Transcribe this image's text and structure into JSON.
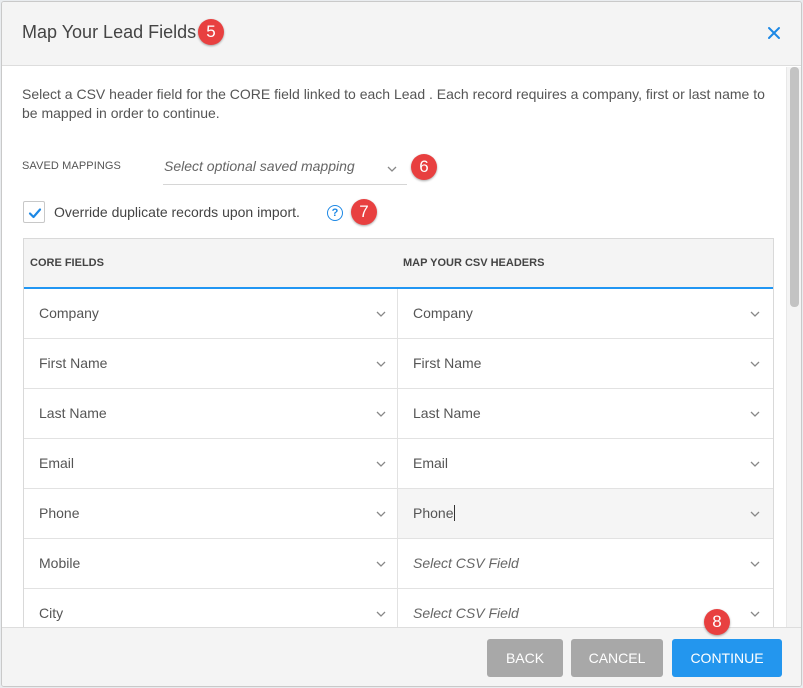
{
  "modal": {
    "title": "Map Your Lead Fields",
    "close_icon": "close-icon"
  },
  "badges": [
    "5",
    "6",
    "7",
    "8"
  ],
  "description": "Select a CSV header field for the CORE field linked to each Lead . Each record requires a company, first or last name to be mapped in order to continue.",
  "saved_mappings": {
    "label": "SAVED MAPPINGS",
    "placeholder": "Select optional saved mapping"
  },
  "override": {
    "checked": true,
    "label": "Override duplicate records upon import.",
    "help": "?"
  },
  "table": {
    "headers": [
      "CORE FIELDS",
      "MAP YOUR CSV HEADERS"
    ],
    "rows": [
      {
        "core": "Company",
        "csv": "Company"
      },
      {
        "core": "First Name",
        "csv": "First Name"
      },
      {
        "core": "Last Name",
        "csv": "Last Name"
      },
      {
        "core": "Email",
        "csv": "Email"
      },
      {
        "core": "Phone",
        "csv": "Phone"
      },
      {
        "core": "Mobile",
        "csv": "Select CSV Field"
      },
      {
        "core": "City",
        "csv": "Select CSV Field"
      }
    ]
  },
  "footer": {
    "back": "BACK",
    "cancel": "CANCEL",
    "continue": "CONTINUE"
  },
  "colors": {
    "accent": "#2396ee",
    "badge": "#e84040",
    "disabled_button": "#a8a8a8"
  }
}
